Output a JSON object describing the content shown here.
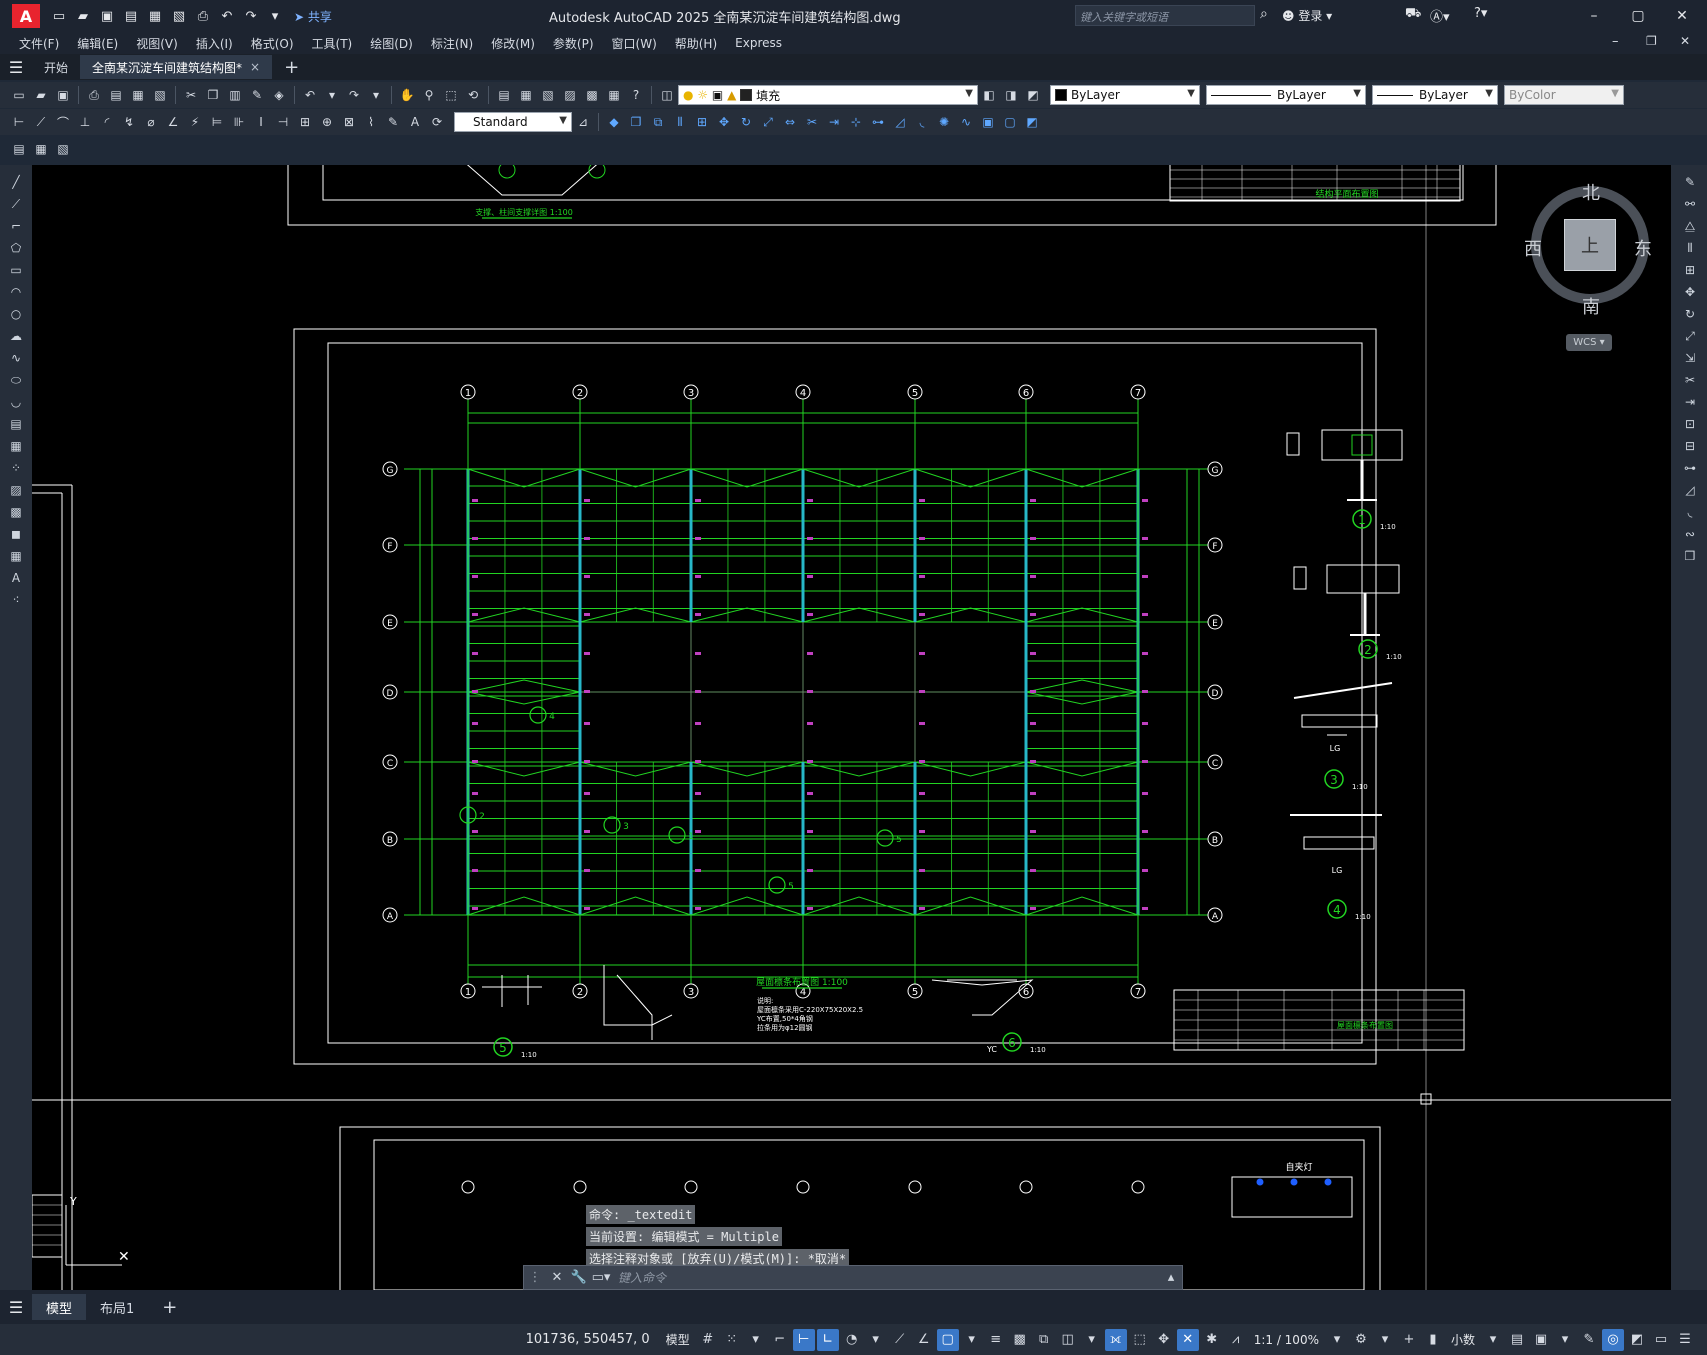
{
  "window": {
    "app_logo": "A",
    "title": "Autodesk AutoCAD 2025    全南某沉淀车间建筑结构图.dwg",
    "share_label": "共享",
    "search_placeholder": "键入关键字或短语",
    "login_label": "登录"
  },
  "menu": [
    "文件(F)",
    "编辑(E)",
    "视图(V)",
    "插入(I)",
    "格式(O)",
    "工具(T)",
    "绘图(D)",
    "标注(N)",
    "修改(M)",
    "参数(P)",
    "窗口(W)",
    "帮助(H)",
    "Express"
  ],
  "tabs": {
    "start": "开始",
    "active_doc": "全南某沉淀车间建筑结构图*",
    "close": "×",
    "add": "+"
  },
  "toolbar2": {
    "layer_value": "填充",
    "color_value": "ByLayer",
    "linetype_value": "ByLayer",
    "lineweight_value": "ByLayer",
    "plotstyle_value": "ByColor"
  },
  "toolbar3": {
    "dimstyle_value": "Standard"
  },
  "viewcube": {
    "north": "北",
    "south": "南",
    "east": "东",
    "west": "西",
    "face": "上",
    "wcs": "WCS"
  },
  "drawing": {
    "grid_numbers": [
      "1",
      "2",
      "3",
      "4",
      "5",
      "6",
      "7"
    ],
    "grid_letters": [
      "G",
      "F",
      "E",
      "D",
      "C",
      "B",
      "A"
    ],
    "plan_title": "屋面檩条布置图 1:100",
    "plan_notes": [
      "说明:",
      "屋面檩条采用C-220X75X20X2.5",
      "YC布置,50*4角钢",
      "拉条用为φ12圆钢"
    ],
    "top_title": "支撑、柱间支撑详图  1:100",
    "title_block_name": "屋面檩条布置图",
    "title_block_top": "结构平面布置图",
    "detail_scale": "1:10",
    "detail_labels": [
      "1",
      "2",
      "3",
      "4",
      "5",
      "6"
    ],
    "detail_captions": [
      "LG",
      "LG",
      "YC"
    ],
    "lower_sheet_title": "自夹灯"
  },
  "command": {
    "history": [
      "命令: _textedit",
      "当前设置: 编辑模式 = Multiple",
      "选择注释对象或 [放弃(U)/模式(M)]: *取消*"
    ],
    "placeholder": "键入命令"
  },
  "layouts": {
    "model": "模型",
    "layout1": "布局1",
    "add": "+"
  },
  "status": {
    "coordinates": "101736, 550457, 0",
    "mode": "模型",
    "scale": "1:1 / 100%",
    "units": "小数"
  },
  "colors": {
    "canvas": "#000000",
    "grid_green": "#22d422",
    "column_cyan": "#27b7c8",
    "frame_white": "#ffffff",
    "accent_blue": "#3a78c8",
    "logo_red": "#e8242e"
  }
}
